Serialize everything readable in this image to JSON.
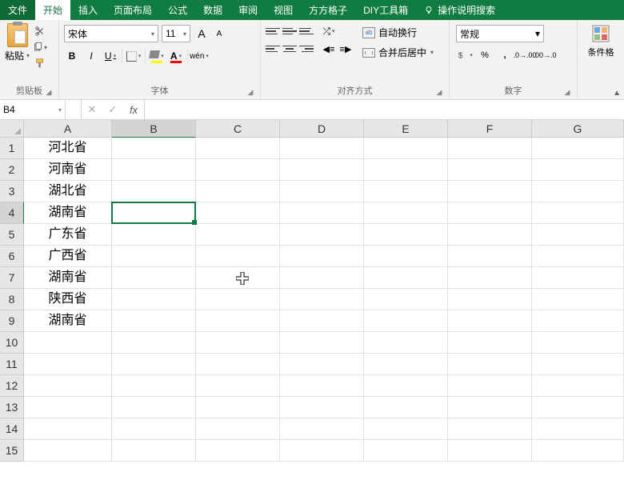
{
  "menu": {
    "file": "文件",
    "home": "开始",
    "insert": "插入",
    "layout": "页面布局",
    "formulas": "公式",
    "data": "数据",
    "review": "审阅",
    "view": "视图",
    "ffgz": "方方格子",
    "diy": "DIY工具箱",
    "tellme": "操作说明搜索"
  },
  "ribbon": {
    "clipboard": {
      "paste": "粘贴",
      "label": "剪贴板"
    },
    "font": {
      "name": "宋体",
      "size": "11",
      "btn_a_big": "A",
      "btn_a_small": "A",
      "bold": "B",
      "italic": "I",
      "underline": "U",
      "wen": "wén",
      "label": "字体"
    },
    "align": {
      "wrap": "自动换行",
      "merge": "合并后居中",
      "label": "对齐方式"
    },
    "number": {
      "format": "常规",
      "label": "数字"
    },
    "cf": {
      "label": "条件格"
    }
  },
  "namebox": "B4",
  "fx": "fx",
  "columns": [
    "A",
    "B",
    "C",
    "D",
    "E",
    "F",
    "G"
  ],
  "colWidths": [
    "colA",
    "colB",
    "colC",
    "colD",
    "colE",
    "colF",
    "colG"
  ],
  "rowCount": 15,
  "cellsA": [
    "河北省",
    "河南省",
    "湖北省",
    "湖南省",
    "广东省",
    "广西省",
    "湖南省",
    "陕西省",
    "湖南省",
    "",
    "",
    "",
    "",
    "",
    ""
  ],
  "selection": {
    "row": 4,
    "col": "B"
  },
  "cursor": {
    "row": 7,
    "col": "C"
  }
}
